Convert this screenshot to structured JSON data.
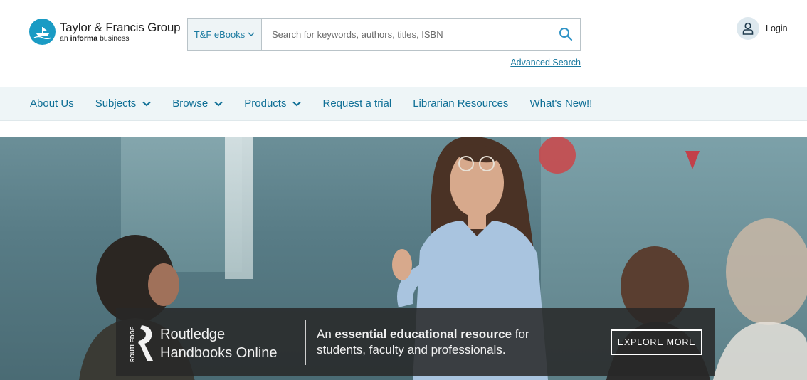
{
  "header": {
    "logo": {
      "name": "Taylor & Francis Group",
      "sub_prefix": "an ",
      "sub_bold": "informa",
      "sub_suffix": " business"
    },
    "search": {
      "scope_label": "T&F eBooks",
      "placeholder": "Search for keywords, authors, titles, ISBN",
      "value": ""
    },
    "advanced_search": "Advanced Search",
    "login": "Login"
  },
  "nav": {
    "items": [
      {
        "label": "About Us",
        "has_dropdown": false
      },
      {
        "label": "Subjects",
        "has_dropdown": true
      },
      {
        "label": "Browse",
        "has_dropdown": true
      },
      {
        "label": "Products",
        "has_dropdown": true
      },
      {
        "label": "Request a trial",
        "has_dropdown": false
      },
      {
        "label": "Librarian Resources",
        "has_dropdown": false
      },
      {
        "label": "What's New!!",
        "has_dropdown": false
      }
    ]
  },
  "hero": {
    "banner": {
      "logo_text": "ROUTLEDGE",
      "product_line1": "Routledge",
      "product_line2": "Handbooks Online",
      "tag_prefix": "An ",
      "tag_bold": "essential educational resource",
      "tag_suffix": " for",
      "tag_line2": "students, faculty and professionals.",
      "cta": "EXPLORE MORE"
    }
  },
  "colors": {
    "brand": "#1a9bc4",
    "link": "#1b7aa0",
    "nav_text": "#0f6f96",
    "nav_bg": "#eef5f7",
    "banner_bg": "#282828"
  }
}
